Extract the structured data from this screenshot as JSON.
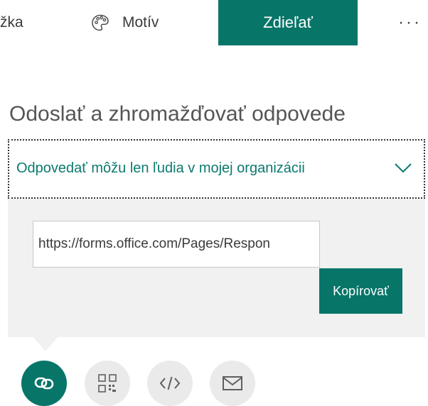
{
  "toolbar": {
    "preview_label": "žka",
    "theme_label": "Motív",
    "share_label": "Zdieľať",
    "more_label": "···"
  },
  "share_section": {
    "title": "Odoslať a zhromažďovať odpovede",
    "permission_dropdown": {
      "selected": "Odpovedať môžu len ľudia v mojej organizácii"
    },
    "link": {
      "url": "https://forms.office.com/Pages/Respon",
      "copy_label": "Kopírovať"
    },
    "methods": [
      {
        "icon": "link-icon",
        "selected": true
      },
      {
        "icon": "qr-code-icon",
        "selected": false
      },
      {
        "icon": "embed-code-icon",
        "selected": false
      },
      {
        "icon": "email-icon",
        "selected": false
      }
    ]
  },
  "colors": {
    "accent": "#077568",
    "accent_text": "#0b7a6e",
    "panel_bg": "#f1f1f1",
    "icon_bg": "#eaeaea"
  }
}
